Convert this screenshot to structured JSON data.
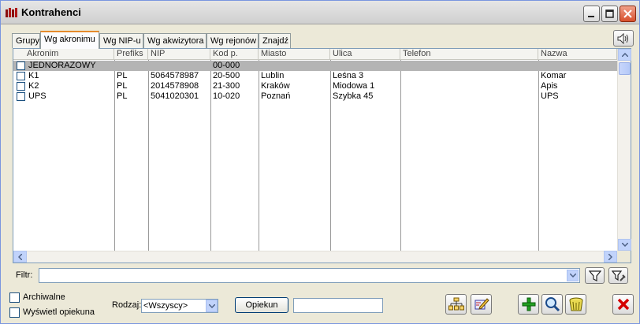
{
  "window": {
    "title": "Kontrahenci"
  },
  "tabs": [
    {
      "label": "Grupy"
    },
    {
      "label": "Wg akronimu"
    },
    {
      "label": "Wg NIP-u"
    },
    {
      "label": "Wg akwizytora"
    },
    {
      "label": "Wg rejonów"
    },
    {
      "label": "Znajdź"
    }
  ],
  "grid": {
    "columns": [
      "Akronim",
      "Prefiks",
      "NIP",
      "Kod p.",
      "Miasto",
      "Ulica",
      "Telefon",
      "Nazwa"
    ],
    "rows": [
      {
        "akronim": "JEDNORAZOWY",
        "prefiks": "",
        "nip": "",
        "kod": "00-000",
        "miasto": "",
        "ulica": "",
        "telefon": "",
        "nazwa": ""
      },
      {
        "akronim": "K1",
        "prefiks": "PL",
        "nip": "5064578987",
        "kod": "20-500",
        "miasto": "Lublin",
        "ulica": "Leśna 3",
        "telefon": "",
        "nazwa": "Komar"
      },
      {
        "akronim": "K2",
        "prefiks": "PL",
        "nip": "2014578908",
        "kod": "21-300",
        "miasto": "Kraków",
        "ulica": "Miodowa 1",
        "telefon": "",
        "nazwa": "Apis"
      },
      {
        "akronim": "UPS",
        "prefiks": "PL",
        "nip": "5041020301",
        "kod": "10-020",
        "miasto": "Poznań",
        "ulica": "Szybka 45",
        "telefon": "",
        "nazwa": "UPS"
      }
    ]
  },
  "filter": {
    "label": "Filtr:",
    "value": ""
  },
  "bottom": {
    "archiwalne_label": "Archiwalne",
    "opiekun_checkbox_label": "Wyświetl opiekuna",
    "rodzaj_label": "Rodzaj:",
    "rodzaj_value": "<Wszyscy>",
    "opiekun_button_label": "Opiekun",
    "opiekun_value": ""
  },
  "icons": {
    "app": "window-icon",
    "sound": "speaker-icon",
    "filter": "funnel-icon",
    "filter_settings": "funnel-wrench-icon",
    "structure": "hierarchy-icon",
    "edit_pencil": "pencil-icon",
    "add": "plus-icon",
    "search": "magnifier-icon",
    "delete_basket": "basket-icon",
    "close": "close-icon"
  },
  "colors": {
    "selected_row": "#b4b4b4",
    "active_tab_accent": "#e68b2c",
    "add_green": "#22a022",
    "close_red": "#d40000"
  }
}
